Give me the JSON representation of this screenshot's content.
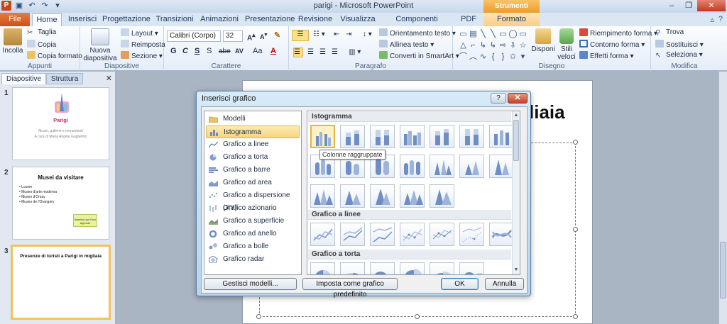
{
  "window": {
    "title": "parigi - Microsoft PowerPoint",
    "context_tab_group": "Strumenti disegno",
    "app_icon": "P"
  },
  "tabs": [
    {
      "label": "File"
    },
    {
      "label": "Home"
    },
    {
      "label": "Inserisci"
    },
    {
      "label": "Progettazione"
    },
    {
      "label": "Transizioni"
    },
    {
      "label": "Animazioni"
    },
    {
      "label": "Presentazione"
    },
    {
      "label": "Revisione"
    },
    {
      "label": "Visualizza"
    },
    {
      "label": "Componenti aggiuntivi"
    },
    {
      "label": "PDF"
    },
    {
      "label": "Formato"
    }
  ],
  "ribbon": {
    "clipboard": {
      "group": "Appunti",
      "paste": "Incolla",
      "cut": "Taglia",
      "copy": "Copia",
      "format_painter": "Copia formato"
    },
    "slides": {
      "group": "Diapositive",
      "new_slide": "Nuova diapositiva",
      "layout": "Layout",
      "reset": "Reimposta",
      "section": "Sezione"
    },
    "font": {
      "group": "Carattere",
      "font_name": "Calibri (Corpo)",
      "font_size": "32",
      "bold": "G",
      "italic": "C",
      "underline": "S",
      "strike": "abe",
      "shadow": "S",
      "spacing": "AV",
      "case": "Aa",
      "color": "A"
    },
    "paragraph": {
      "group": "Paragrafo",
      "text_direction": "Orientamento testo",
      "align_text": "Allinea testo",
      "smartart": "Converti in SmartArt"
    },
    "drawing": {
      "group": "Disegno",
      "arrange": "Disponi",
      "quick_styles": "Stili veloci",
      "shape_fill": "Riempimento forma",
      "shape_outline": "Contorno forma",
      "shape_effects": "Effetti forma"
    },
    "editing": {
      "group": "Modifica",
      "find": "Trova",
      "replace": "Sostituisci",
      "select": "Seleziona"
    }
  },
  "slide_pane": {
    "tabs": [
      "Diapositive",
      "Struttura"
    ],
    "slides": [
      {
        "number": "1",
        "title": "Parigi",
        "subtitle": "Musei, gallerie e monumenti",
        "author": "A cura di Maria Angela Guglielmo"
      },
      {
        "number": "2",
        "title": "Musei da visitare",
        "bullets": [
          "Louvre",
          "Museo d'arte moderna",
          "Museo d'Orsay",
          "Museo de l'Orangery"
        ],
        "note": "Inserisci qui il tuo appunto"
      },
      {
        "number": "3",
        "title": "Presenze di turisti  a Parigi in migliaia"
      }
    ]
  },
  "slide": {
    "title_fragment": "liaia"
  },
  "dialog": {
    "title": "Inserisci grafico",
    "help": "?",
    "categories": [
      {
        "label": "Modelli",
        "icon": "folder-icon"
      },
      {
        "label": "Istogramma",
        "icon": "column-chart-icon"
      },
      {
        "label": "Grafico a linee",
        "icon": "line-chart-icon"
      },
      {
        "label": "Grafico a torta",
        "icon": "pie-chart-icon"
      },
      {
        "label": "Grafico a barre",
        "icon": "bar-chart-icon"
      },
      {
        "label": "Grafico ad area",
        "icon": "area-chart-icon"
      },
      {
        "label": "Grafico a dispersione (XY)",
        "icon": "scatter-chart-icon"
      },
      {
        "label": "Grafico azionario",
        "icon": "stock-chart-icon"
      },
      {
        "label": "Grafico a superficie",
        "icon": "surface-chart-icon"
      },
      {
        "label": "Grafico ad anello",
        "icon": "doughnut-chart-icon"
      },
      {
        "label": "Grafico a bolle",
        "icon": "bubble-chart-icon"
      },
      {
        "label": "Grafico radar",
        "icon": "radar-chart-icon"
      }
    ],
    "selected_category": "Istogramma",
    "sections": [
      {
        "heading": "Istogramma"
      },
      {
        "heading": "Grafico a linee"
      },
      {
        "heading": "Grafico a torta"
      }
    ],
    "tooltip": "Colonne raggruppate",
    "buttons": {
      "manage_templates": "Gestisci modelli...",
      "set_default": "Imposta come grafico predefinito",
      "ok": "OK",
      "cancel": "Annulla"
    }
  },
  "colors": {
    "accent_file": "#c9521b",
    "context_orange": "#ee9b2b",
    "selection_gold": "#f8d57e",
    "chart_blue": "#6f8fc4"
  }
}
